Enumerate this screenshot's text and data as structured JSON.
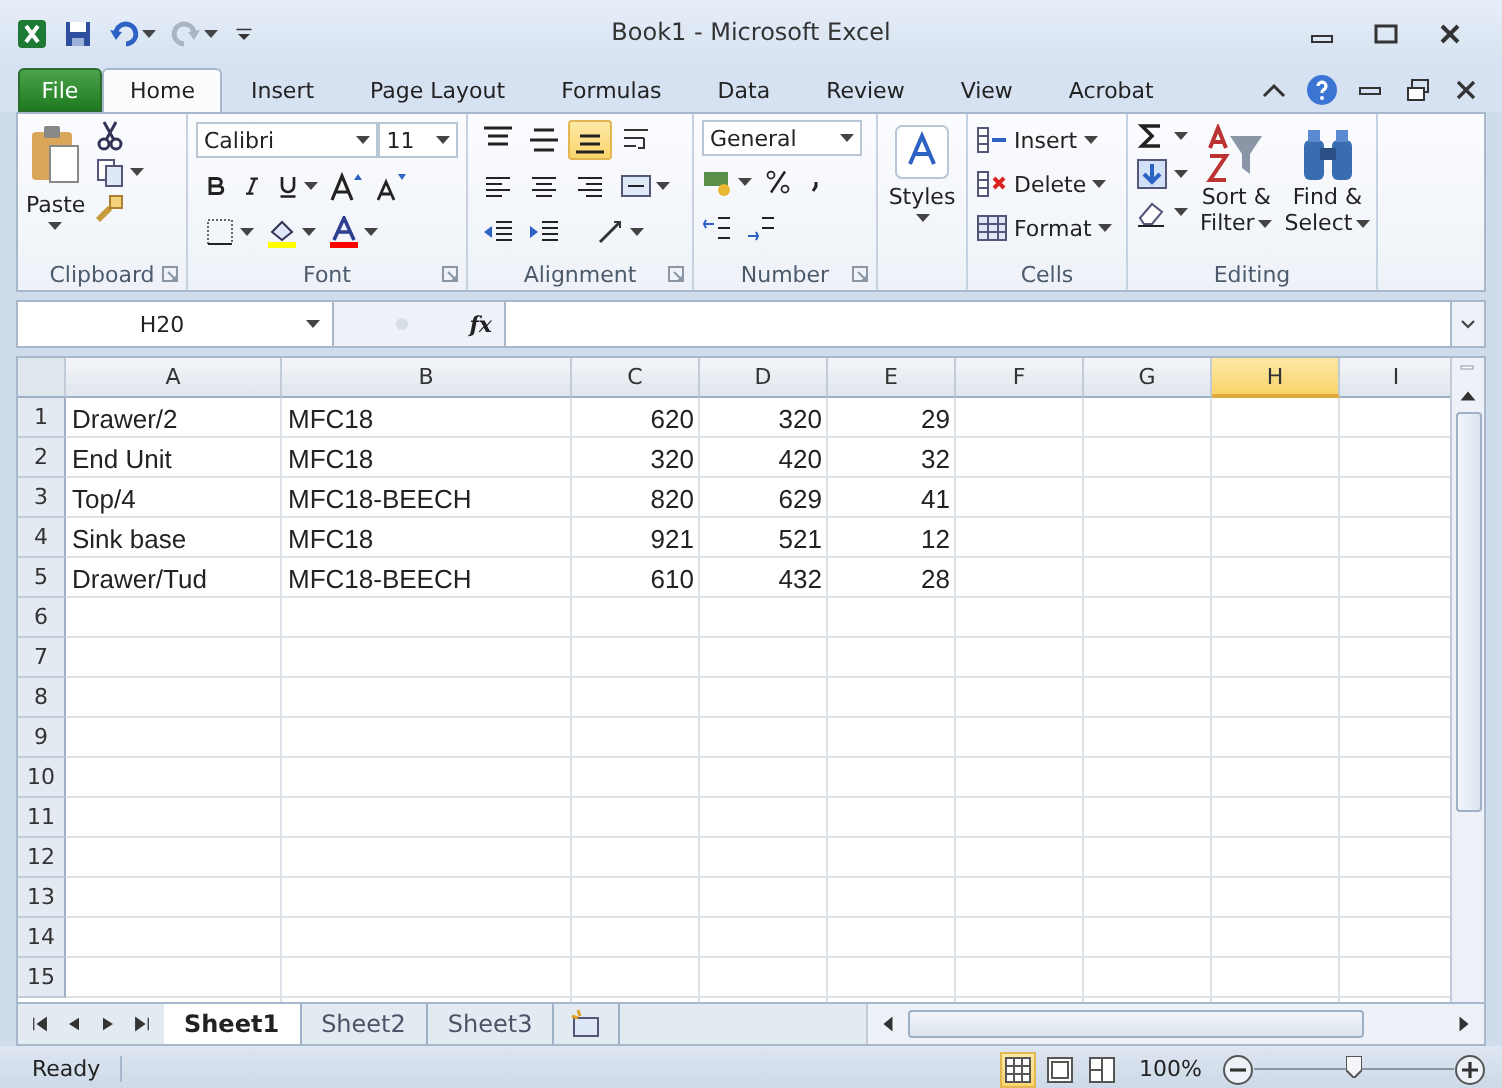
{
  "window": {
    "title": "Book1  -  Microsoft Excel"
  },
  "file_tab": {
    "label": "File"
  },
  "tabs": [
    {
      "label": "Home",
      "selected": true
    },
    {
      "label": "Insert",
      "selected": false
    },
    {
      "label": "Page Layout",
      "selected": false
    },
    {
      "label": "Formulas",
      "selected": false
    },
    {
      "label": "Data",
      "selected": false
    },
    {
      "label": "Review",
      "selected": false
    },
    {
      "label": "View",
      "selected": false
    },
    {
      "label": "Acrobat",
      "selected": false
    }
  ],
  "ribbon": {
    "clipboard": {
      "label": "Clipboard",
      "paste": "Paste"
    },
    "font": {
      "label": "Font",
      "family": "Calibri",
      "size": "11"
    },
    "alignment": {
      "label": "Alignment",
      "vertical": [
        {
          "selected": false
        },
        {
          "selected": false
        },
        {
          "selected": true
        }
      ]
    },
    "number": {
      "label": "Number",
      "format": "General"
    },
    "styles": {
      "label": "Styles"
    },
    "cells": {
      "label": "Cells",
      "buttons": [
        "Insert",
        "Delete",
        "Format"
      ]
    },
    "editing": {
      "label": "Editing",
      "buttons": [
        [
          "Sort &",
          "Filter"
        ],
        [
          "Find &",
          "Select"
        ]
      ]
    }
  },
  "formula_bar": {
    "name_box": "H20",
    "fx": "fx"
  },
  "columns": [
    {
      "label": "A",
      "selected": false,
      "kind": "text"
    },
    {
      "label": "B",
      "selected": false,
      "kind": "text"
    },
    {
      "label": "C",
      "selected": false,
      "kind": "number"
    },
    {
      "label": "D",
      "selected": false,
      "kind": "number"
    },
    {
      "label": "E",
      "selected": false,
      "kind": "number"
    },
    {
      "label": "F",
      "selected": false
    },
    {
      "label": "G",
      "selected": false
    },
    {
      "label": "H",
      "selected": true
    },
    {
      "label": "I",
      "selected": false
    }
  ],
  "rows": [
    {
      "number": "1",
      "cells": [
        "Drawer/2",
        "MFC18",
        "620",
        "320",
        "29"
      ]
    },
    {
      "number": "2",
      "cells": [
        "End Unit",
        "MFC18",
        "320",
        "420",
        "32"
      ]
    },
    {
      "number": "3",
      "cells": [
        "Top/4",
        "MFC18-BEECH",
        "820",
        "629",
        "41"
      ]
    },
    {
      "number": "4",
      "cells": [
        "Sink base",
        "MFC18",
        "921",
        "521",
        "12"
      ]
    },
    {
      "number": "5",
      "cells": [
        "Drawer/Tud",
        "MFC18-BEECH",
        "610",
        "432",
        "28"
      ]
    },
    {
      "number": "6"
    },
    {
      "number": "7"
    },
    {
      "number": "8"
    },
    {
      "number": "9"
    },
    {
      "number": "10"
    },
    {
      "number": "11"
    },
    {
      "number": "12"
    },
    {
      "number": "13"
    },
    {
      "number": "14"
    },
    {
      "number": "15"
    }
  ],
  "sheets": [
    {
      "label": "Sheet1",
      "selected": true
    },
    {
      "label": "Sheet2",
      "selected": false
    },
    {
      "label": "Sheet3",
      "selected": false
    }
  ],
  "status_bar": {
    "status": "Ready",
    "views": [
      {
        "selected": true
      },
      {
        "selected": false
      },
      {
        "selected": false
      }
    ],
    "zoom": "100%",
    "zoom_slider": {
      "level": 0.5
    }
  }
}
